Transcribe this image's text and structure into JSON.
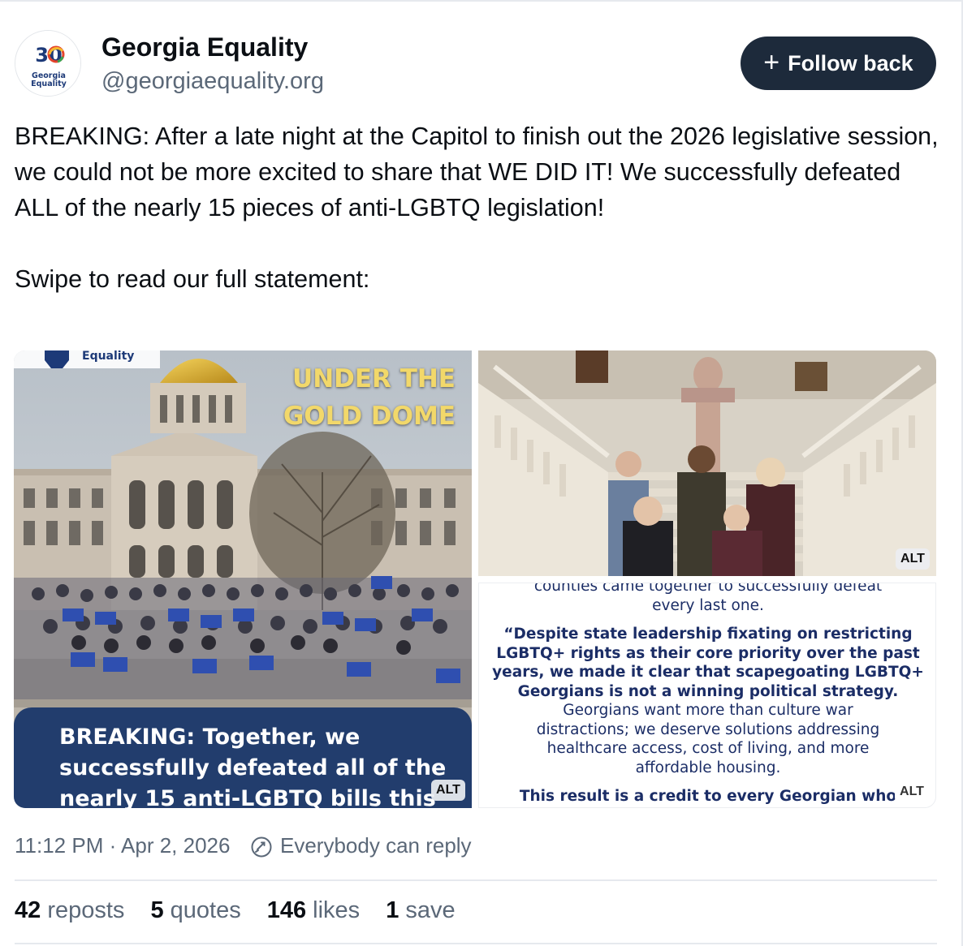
{
  "author": {
    "avatar_icon": "georgia-equality-30-logo",
    "avatar_text_top": "30",
    "avatar_text_bottom": "Georgia Equality",
    "display_name": "Georgia Equality",
    "handle": "@georgiaequality.org"
  },
  "follow_button": {
    "icon": "plus-icon",
    "plus": "+",
    "label": "Follow back"
  },
  "post": {
    "paragraphs": [
      "BREAKING: After a late night at the Capitol to finish out the 2026 legislative session, we could not be more excited to share that WE DID IT! We successfully defeated ALL of the nearly 15 pieces of anti-LGBTQ legislation!",
      "Swipe to read our full statement:"
    ]
  },
  "media": {
    "left": {
      "overlay_line1": "UNDER THE",
      "overlay_line2": "GOLD DOME",
      "breaking_text": "BREAKING: Together, we successfully defeated all of the nearly 15 anti-LGBTQ bills this",
      "alt": "ALT"
    },
    "right_top": {
      "alt": "ALT"
    },
    "right_bottom": {
      "line_partial": "counties came together to successfully defeat",
      "line_a": "every last one.",
      "quote_lines": [
        "“Despite state leadership fixating on restricting",
        "LGBTQ+ rights as their core priority over the past",
        "years, we made it clear that scapegoating LGBTQ+",
        "Georgians is not a winning political strategy."
      ],
      "body_lines": [
        "Georgians want more than culture war",
        "distractions; we deserve solutions addressing",
        "healthcare access, cost of living, and more",
        "affordable housing."
      ],
      "final_line": "This result is a credit to every Georgian who",
      "alt": "ALT"
    }
  },
  "meta": {
    "timestamp": "11:12 PM · Apr 2, 2026",
    "reply_icon": "reply-settings-icon",
    "reply_setting": "Everybody can reply"
  },
  "stats": {
    "reposts_count": "42",
    "reposts_label": "reposts",
    "quotes_count": "5",
    "quotes_label": "quotes",
    "likes_count": "146",
    "likes_label": "likes",
    "saves_count": "1",
    "saves_label": "save"
  }
}
